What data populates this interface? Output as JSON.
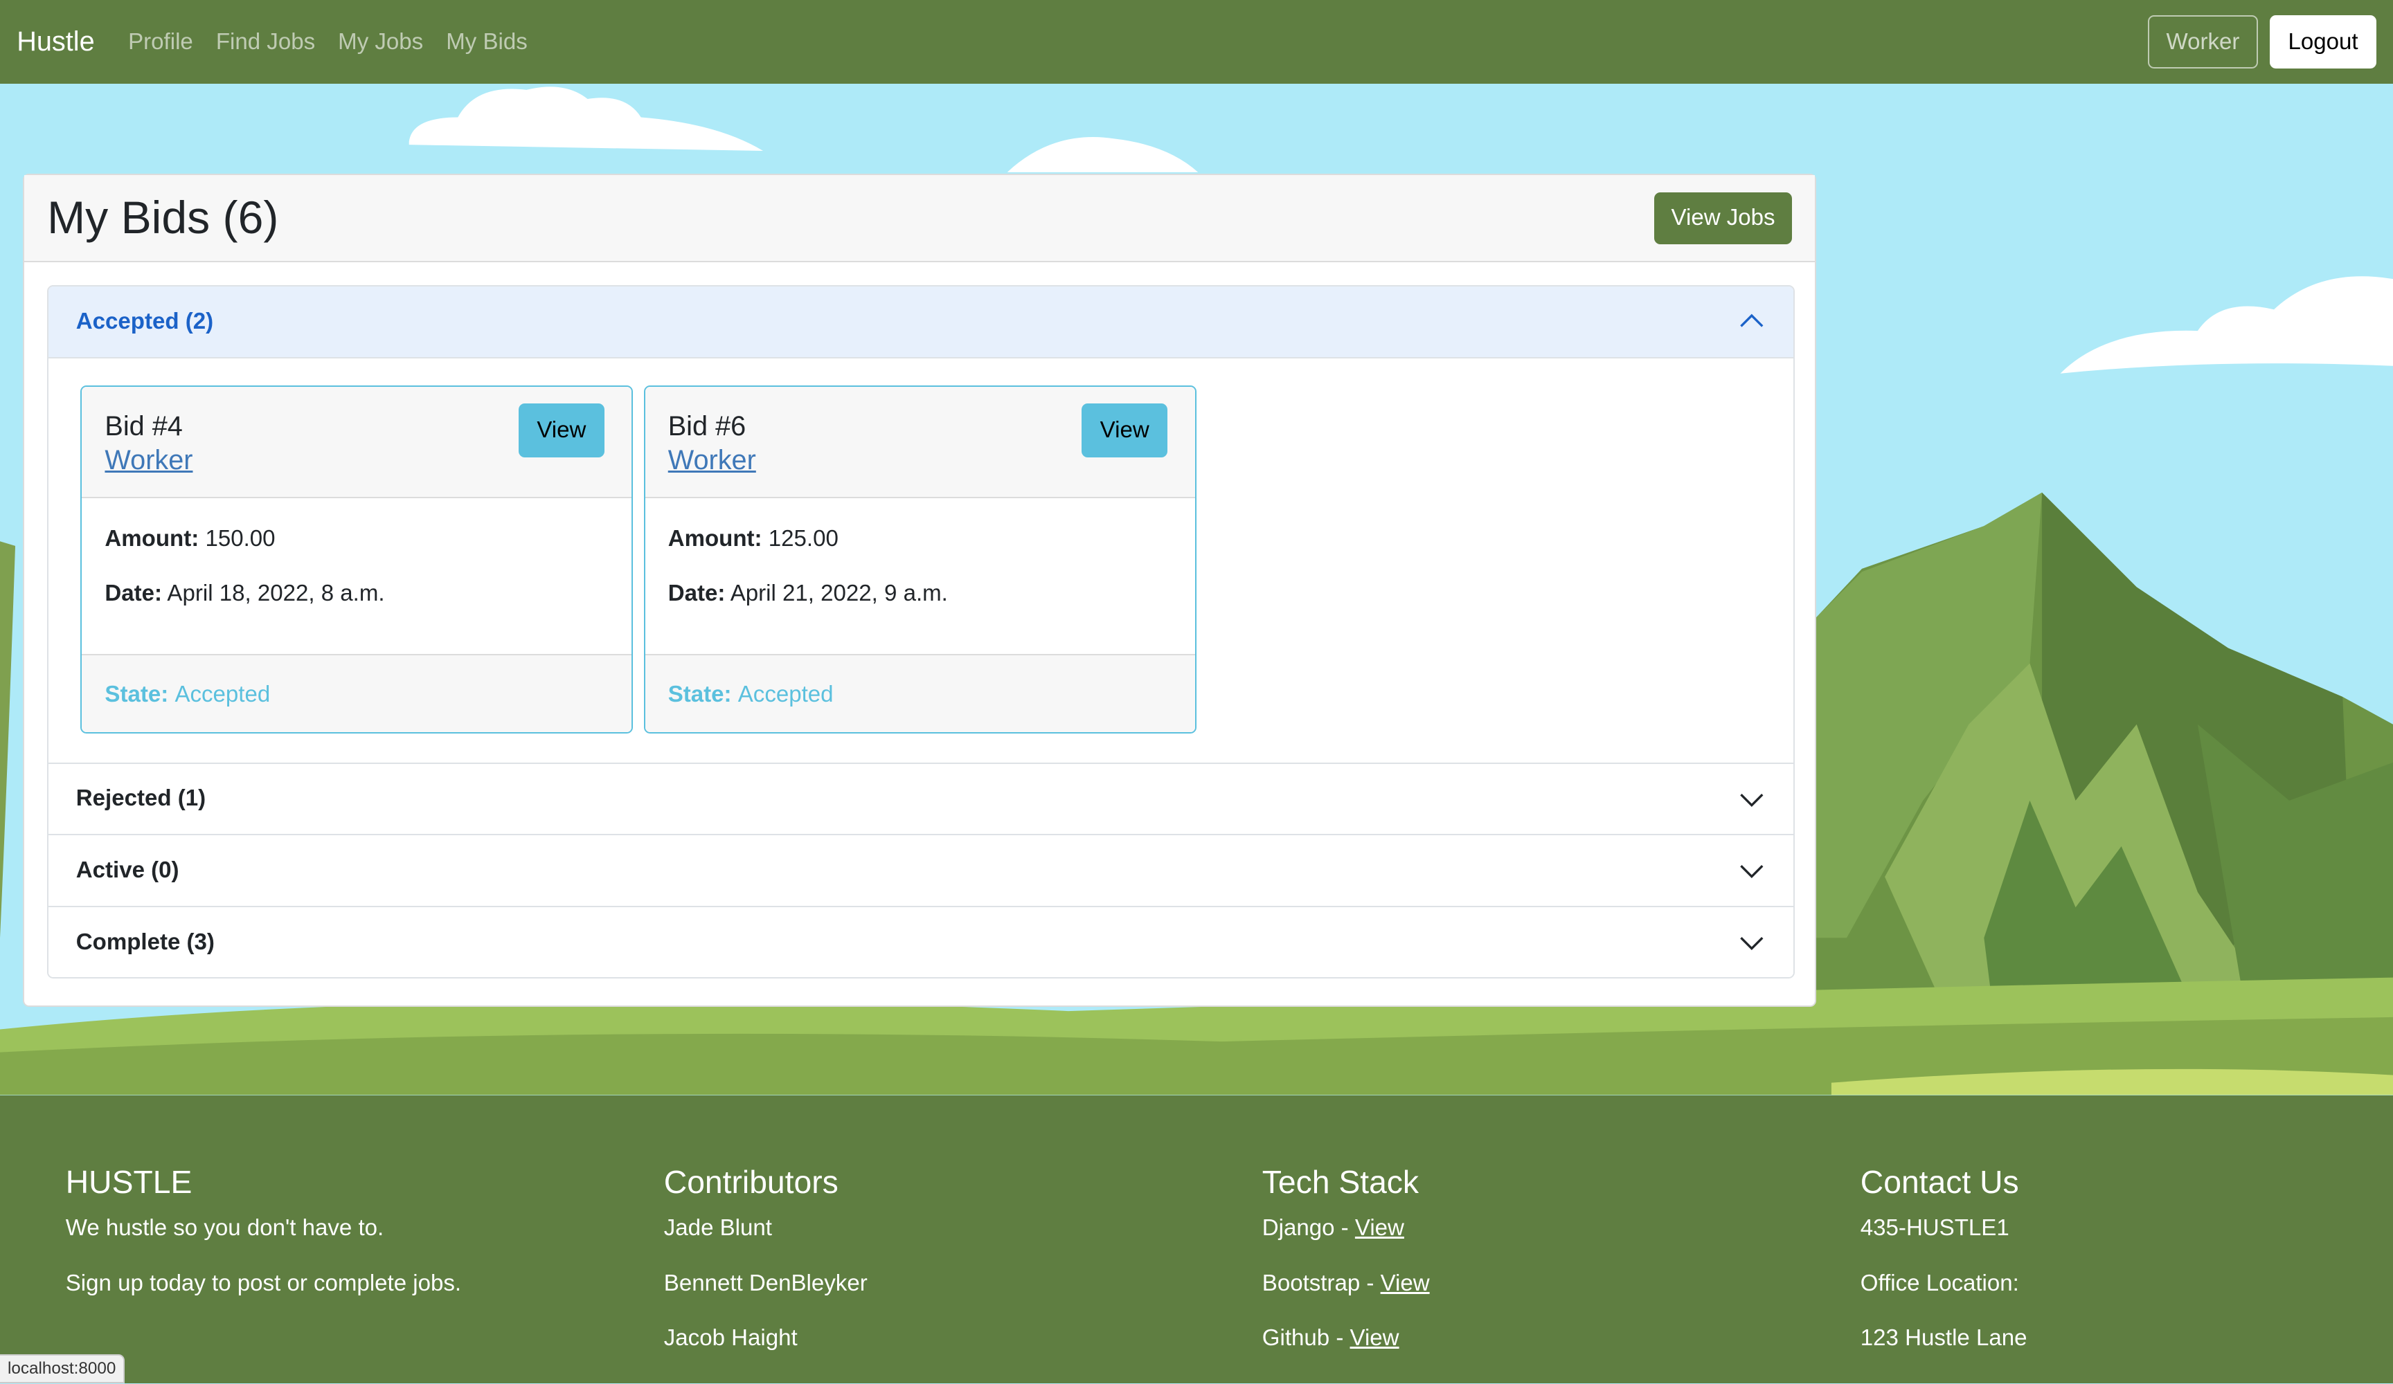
{
  "navbar": {
    "brand": "Hustle",
    "links": [
      "Profile",
      "Find Jobs",
      "My Jobs",
      "My Bids"
    ],
    "user_button": "Worker",
    "logout_button": "Logout"
  },
  "page": {
    "title": "My Bids (6)",
    "view_jobs_button": "View Jobs"
  },
  "accordion": {
    "accepted": "Accepted (2)",
    "rejected": "Rejected (1)",
    "active": "Active (0)",
    "complete": "Complete (3)"
  },
  "bids": [
    {
      "title": "Bid #4",
      "worker": "Worker",
      "view_label": "View",
      "amount_label": "Amount:",
      "amount": "150.00",
      "date_label": "Date:",
      "date": "April 18, 2022, 8 a.m.",
      "state_label": "State:",
      "state": "Accepted"
    },
    {
      "title": "Bid #6",
      "worker": "Worker",
      "view_label": "View",
      "amount_label": "Amount:",
      "amount": "125.00",
      "date_label": "Date:",
      "date": "April 21, 2022, 9 a.m.",
      "state_label": "State:",
      "state": "Accepted"
    }
  ],
  "footer": {
    "hustle": {
      "heading": "HUSTLE",
      "line1": "We hustle so you don't have to.",
      "line2": "Sign up today to post or complete jobs."
    },
    "contributors": {
      "heading": "Contributors",
      "names": [
        "Jade Blunt",
        "Bennett DenBleyker",
        "Jacob Haight"
      ]
    },
    "tech": {
      "heading": "Tech Stack",
      "items": [
        {
          "name": "Django - ",
          "link": "View"
        },
        {
          "name": "Bootstrap - ",
          "link": "View"
        },
        {
          "name": "Github - ",
          "link": "View"
        }
      ]
    },
    "contact": {
      "heading": "Contact Us",
      "phone": "435-HUSTLE1",
      "office_label": "Office Location:",
      "address": "123 Hustle Lane"
    }
  },
  "status_url": "localhost:8000",
  "colors": {
    "navbar": "#5f7e41",
    "accent_info": "#5bc0de",
    "accordion_open": "#e7f0fc",
    "sky": "#aeeaf8"
  }
}
